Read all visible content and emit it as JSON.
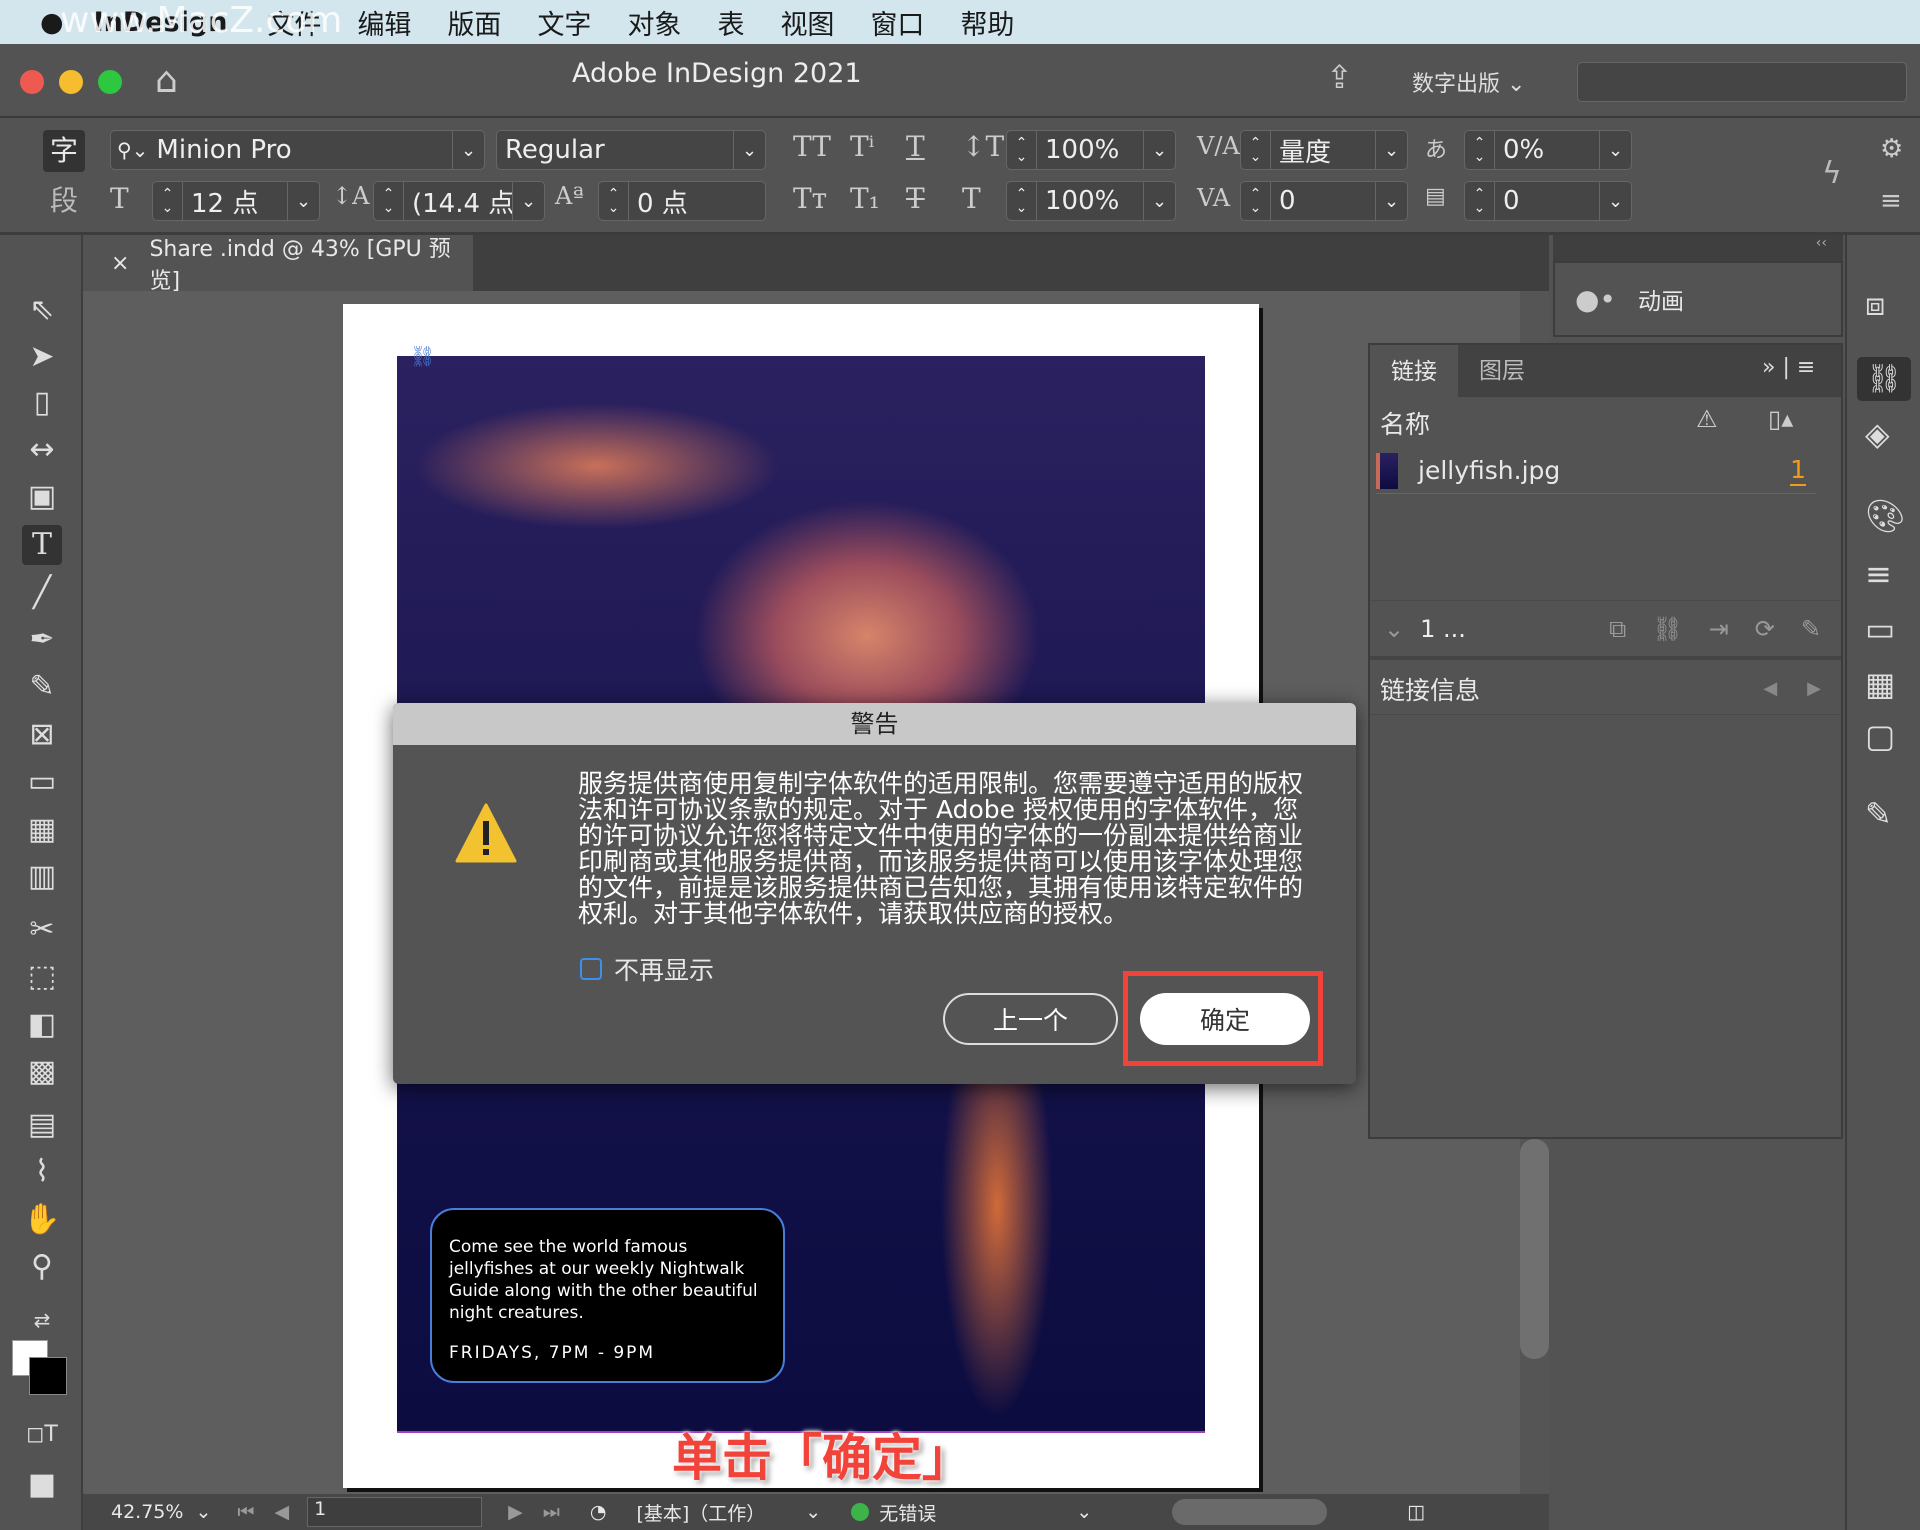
{
  "menubar": {
    "watermark": "www.MacZ.com",
    "app": "InDesign",
    "items": [
      "文件",
      "编辑",
      "版面",
      "文字",
      "对象",
      "表",
      "视图",
      "窗口",
      "帮助"
    ]
  },
  "titlebar": {
    "title": "Adobe InDesign 2021",
    "workspace": "数字出版",
    "search_placeholder": ""
  },
  "control": {
    "char_tab": "字",
    "para_tab": "段",
    "font": "Minion Pro",
    "style": "Regular",
    "size": "12 点",
    "leading": "(14.4 点",
    "baseline": "0 点",
    "vscale": "100%",
    "hscale": "100%",
    "kerning": "量度",
    "tracking": "0",
    "tsume": "0%",
    "grid": "0"
  },
  "document": {
    "tab": "Share .indd @ 43% [GPU 预览]",
    "caption": "Come see the world famous jellyfishes at our weekly Nightwalk Guide along with the other beautiful night creatures.",
    "caption_time": "FRIDAYS, 7PM - 9PM"
  },
  "dialog": {
    "title": "警告",
    "message": "服务提供商使用复制字体软件的适用限制。您需要遵守适用的版权法和许可协议条款的规定。对于 Adobe 授权使用的字体软件，您的许可协议允许您将特定文件中使用的字体的一份副本提供给商业印刷商或其他服务提供商，而该服务提供商可以使用该字体处理您的文件，前提是该服务提供商已告知您，其拥有使用该特定软件的权利。对于其他字体软件，请获取供应商的授权。",
    "checkbox": "不再显示",
    "checked": false,
    "prev": "上一个",
    "ok": "确定"
  },
  "annotation": "单击「确定」",
  "panels": {
    "animation": "动画",
    "tabs": [
      "链接",
      "图层"
    ],
    "col_name": "名称",
    "links": [
      {
        "name": "jellyfish.jpg",
        "page": "1"
      }
    ],
    "count": "1 ...",
    "link_info": "链接信息"
  },
  "status": {
    "zoom": "42.75%",
    "page": "1",
    "profile": "[基本]（工作）",
    "preflight": "无错误",
    "preflight_color": "#3cb44a"
  },
  "colors": {
    "accent_red": "#f2433a",
    "warning": "#f2c230"
  }
}
